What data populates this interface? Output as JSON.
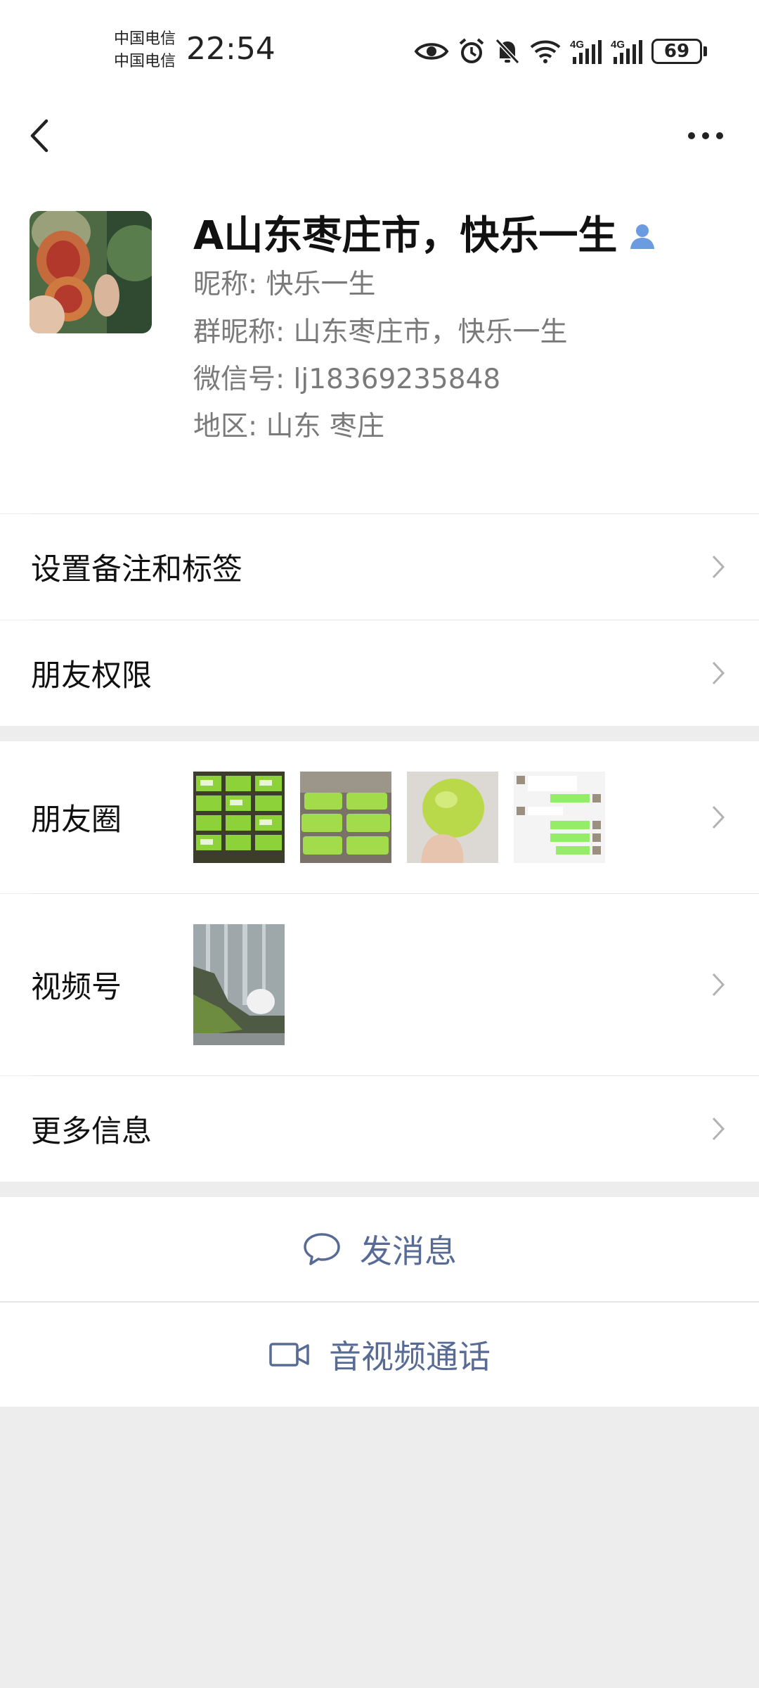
{
  "status_bar": {
    "carrier_1": "中国电信",
    "carrier_2": "中国电信",
    "time": "22:54",
    "battery": "69",
    "network_1": "4G",
    "network_2": "4G"
  },
  "profile": {
    "display_name": "A山东枣庄市，快乐一生",
    "nickname": "昵称:  快乐一生",
    "group_nickname": "群昵称:  山东枣庄市，快乐一生",
    "wechat_id": "微信号:  lj18369235848",
    "region": "地区:  山东  枣庄"
  },
  "menu": {
    "remark": "设置备注和标签",
    "permissions": "朋友权限",
    "moments": "朋友圈",
    "channels": "视频号",
    "more_info": "更多信息"
  },
  "actions": {
    "message": "发消息",
    "call": "音视频通话"
  },
  "colors": {
    "link": "#576b95",
    "page_bg": "#ededed",
    "wechat_green": "#95ec69"
  }
}
